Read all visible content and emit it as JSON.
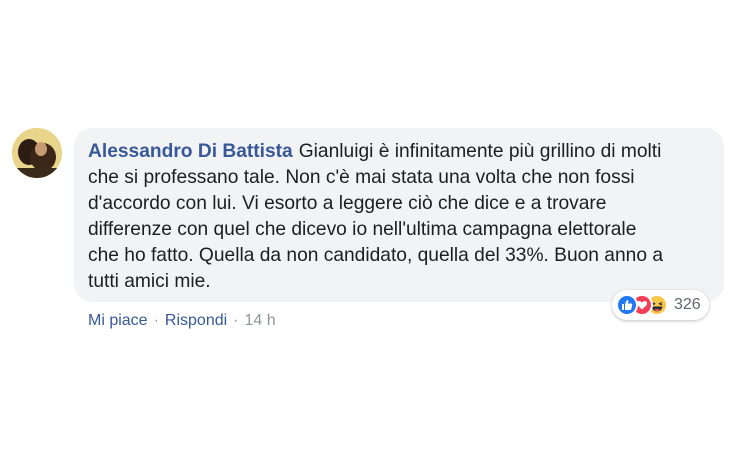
{
  "comment": {
    "author": "Alessandro Di Battista",
    "text_lines": [
      "Gianluigi è infinitamente più grillino di molti",
      "che si professano tale. Non c'è mai stata una volta che non fossi",
      "d'accordo con lui. Vi esorto a leggere ciò che dice e a trovare",
      "differenze con quel che dicevo io nell'ultima campagna elettorale",
      "che ho fatto. Quella da non candidato, quella del 33%. Buon anno a",
      "tutti amici mie."
    ]
  },
  "reactions": {
    "icons": [
      "like-icon",
      "love-icon",
      "haha-icon"
    ],
    "count": "326"
  },
  "actions": {
    "like_label": "Mi piace",
    "separator": "·",
    "reply_label": "Rispondi",
    "timestamp": "14 h"
  },
  "colors": {
    "author": "#385898",
    "bubble": "#f2f3f5",
    "like": "#2078f4",
    "love": "#f33e58",
    "haha": "#fcc748"
  }
}
